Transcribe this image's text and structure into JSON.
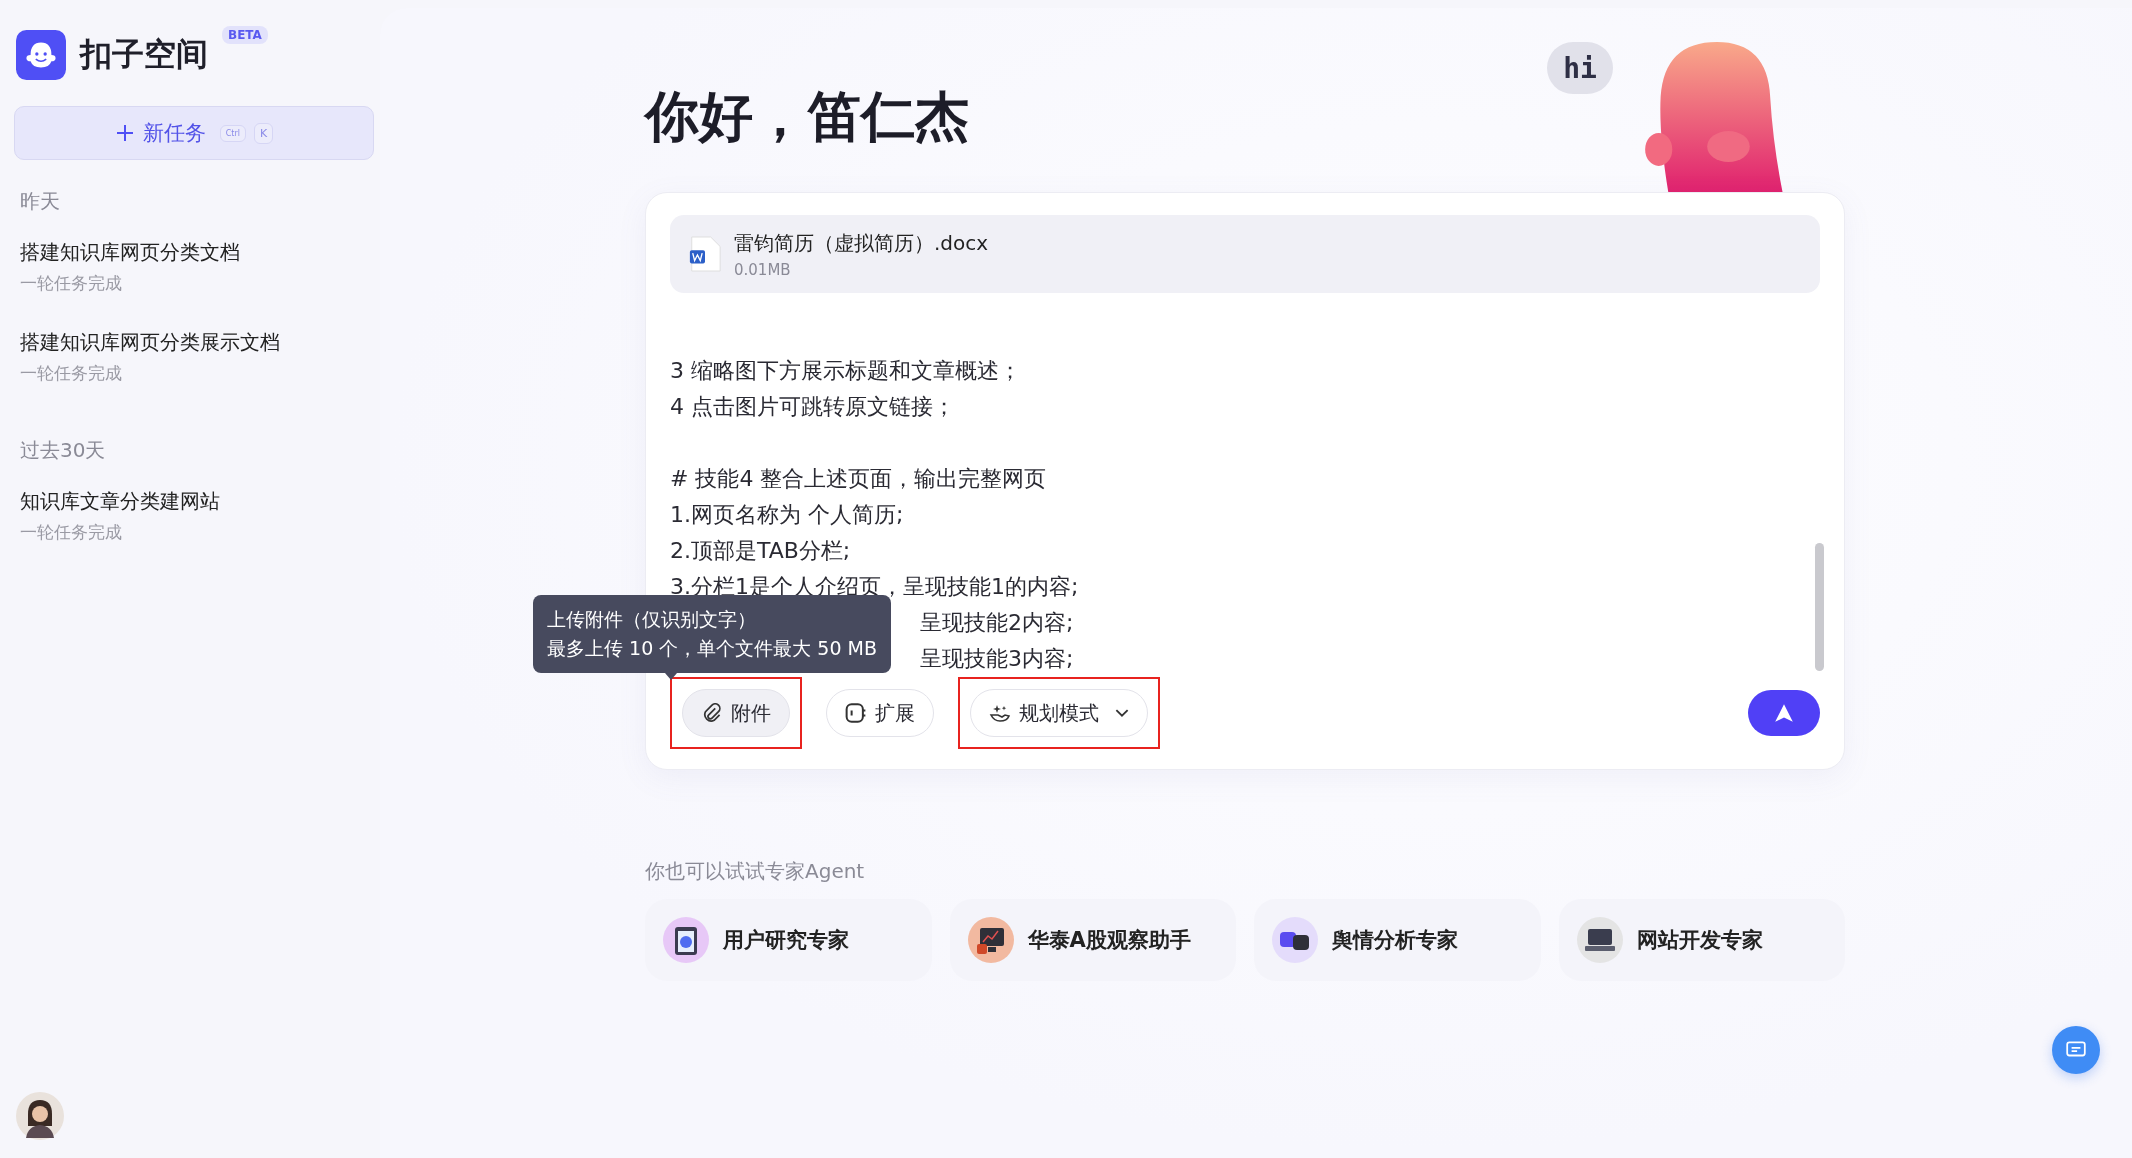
{
  "sidebar": {
    "logo": {
      "name": "扣子空间",
      "badge": "BETA"
    },
    "new_task": {
      "label": "新任务",
      "keys": [
        "Ctrl",
        "K"
      ]
    },
    "groups": [
      {
        "title": "昨天",
        "items": [
          {
            "title": "搭建知识库网页分类文档",
            "subtitle": "一轮任务完成"
          },
          {
            "title": "搭建知识库网页分类展示文档",
            "subtitle": "一轮任务完成"
          }
        ]
      },
      {
        "title": "过去30天",
        "items": [
          {
            "title": "知识库文章分类建网站",
            "subtitle": "一轮任务完成"
          }
        ]
      }
    ]
  },
  "greeting": "你好，笛仁杰",
  "mascot": {
    "bubble": "hi"
  },
  "composer": {
    "attachment": {
      "name": "雷钧简历（虚拟简历）.docx",
      "size": "0.01MB"
    },
    "paragraphs": [
      [
        "3 缩略图下方展示标题和文章概述；",
        "4 点击图片可跳转原文链接；"
      ],
      [
        "# 技能4 整合上述页面，输出完整网页",
        "1.网页名称为 个人简历;",
        "2.顶部是TAB分栏;",
        "3.分栏1是个人介绍页，呈现技能1的内容;"
      ]
    ],
    "covered_lines": [
      "呈现技能2内容;",
      "呈现技能3内容;"
    ],
    "tooltip": [
      "上传附件（仅识别文字）",
      "最多上传 10 个，单个文件最大 50 MB"
    ],
    "tools": [
      {
        "kind": "attach",
        "label": "附件",
        "highlighted": true,
        "dropdown": false
      },
      {
        "kind": "extend",
        "label": "扩展",
        "highlighted": false,
        "dropdown": false
      },
      {
        "kind": "plan",
        "label": "规划模式",
        "highlighted": true,
        "dropdown": true
      }
    ]
  },
  "agents": {
    "title": "你也可以试试专家Agent",
    "items": [
      {
        "kind": "research",
        "name": "用户研究专家"
      },
      {
        "kind": "stock",
        "name": "华泰A股观察助手"
      },
      {
        "kind": "opinion",
        "name": "舆情分析专家"
      },
      {
        "kind": "web",
        "name": "网站开发专家"
      }
    ]
  }
}
